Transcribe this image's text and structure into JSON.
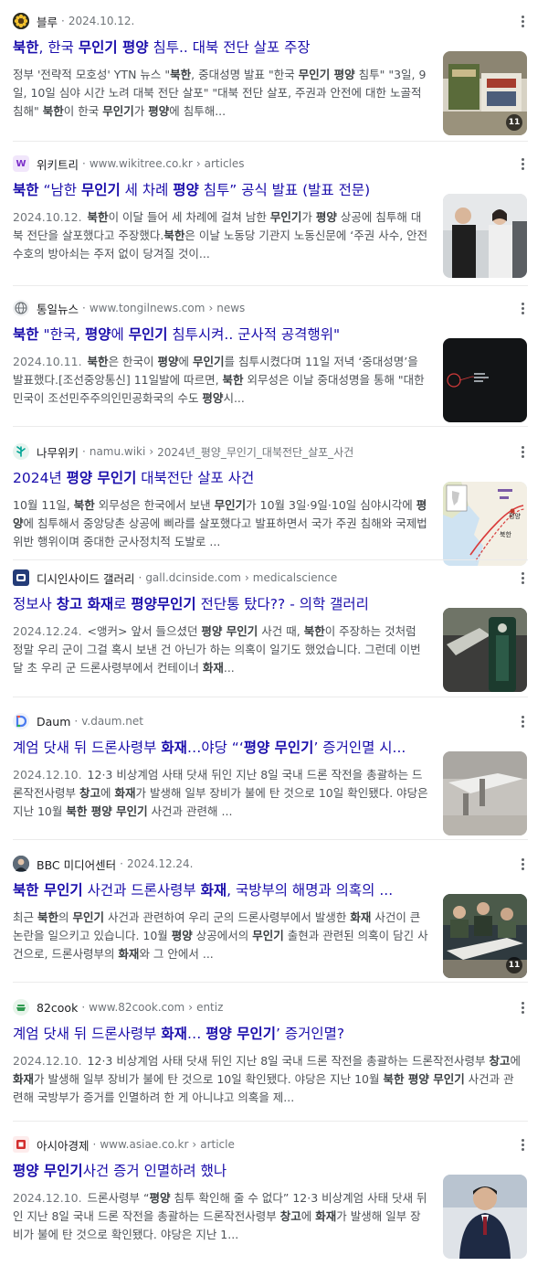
{
  "results": [
    {
      "favicon": "sunflower-favicon-icon",
      "source": "블루",
      "date": "2024.10.12.",
      "title_parts": [
        [
          "b",
          "북한"
        ],
        [
          "t",
          ", 한국 "
        ],
        [
          "b",
          "무인기 평양"
        ],
        [
          "t",
          " 침투.. 대북 전단 살포 주장"
        ]
      ],
      "snippet_parts": [
        [
          "t",
          "정부 '전략적 모호성' YTN 뉴스 \""
        ],
        [
          "b",
          "북한"
        ],
        [
          "t",
          ", 중대성명 발표 \"한국 "
        ],
        [
          "b",
          "무인기 평양"
        ],
        [
          "t",
          " 침투\" \"3일, 9일, 10일 심야 시간 노려 대북 전단 살포\" \"대북 전단 살포, 주권과 안전에 대한 노골적 침해\" "
        ],
        [
          "b",
          "북한"
        ],
        [
          "t",
          "이 한국 "
        ],
        [
          "b",
          "무인기"
        ],
        [
          "t",
          "가 "
        ],
        [
          "b",
          "평양"
        ],
        [
          "t",
          "에 침투해..."
        ]
      ],
      "image_count": "11"
    },
    {
      "favicon": "wikitree-favicon-icon",
      "source": "위키트리",
      "url": "www.wikitree.co.kr",
      "path": "articles",
      "title_parts": [
        [
          "b",
          "북한"
        ],
        [
          "t",
          " “남한 "
        ],
        [
          "b",
          "무인기"
        ],
        [
          "t",
          " 세 차례 "
        ],
        [
          "b",
          "평양"
        ],
        [
          "t",
          " 침투” 공식 발표 (발표 전문)"
        ]
      ],
      "date": "2024.10.12.",
      "snippet_parts": [
        [
          "b",
          "북한"
        ],
        [
          "t",
          "이 이달 들어 세 차례에 걸쳐 남한 "
        ],
        [
          "b",
          "무인기"
        ],
        [
          "t",
          "가 "
        ],
        [
          "b",
          "평양"
        ],
        [
          "t",
          " 상공에 침투해 대북 전단을 살포했다고 주장했다."
        ],
        [
          "b",
          "북한"
        ],
        [
          "t",
          "은 이날 노동당 기관지 노동신문에 ‘주권 사수, 안전 수호의 방아쇠는 주저 없이 당겨질 것이..."
        ]
      ]
    },
    {
      "favicon": "globe-favicon-icon",
      "source": "통일뉴스",
      "url": "www.tongilnews.com",
      "path": "news",
      "title_parts": [
        [
          "b",
          "북한"
        ],
        [
          "t",
          " \"한국, "
        ],
        [
          "b",
          "평양"
        ],
        [
          "t",
          "에 "
        ],
        [
          "b",
          "무인기"
        ],
        [
          "t",
          " 침투시켜.. 군사적 공격행위\""
        ]
      ],
      "date": "2024.10.11.",
      "snippet_parts": [
        [
          "b",
          "북한"
        ],
        [
          "t",
          "은 한국이 "
        ],
        [
          "b",
          "평양"
        ],
        [
          "t",
          "에 "
        ],
        [
          "b",
          "무인기"
        ],
        [
          "t",
          "를 침투시켰다며 11일 저녁 ‘중대성명’을 발표했다.[조선중앙통신] 11일발에 따르면, "
        ],
        [
          "b",
          "북한"
        ],
        [
          "t",
          " 외무성은 이날 중대성명을 통해 \"대한민국이 조선민주주의인민공화국의 수도 "
        ],
        [
          "b",
          "평양"
        ],
        [
          "t",
          "시..."
        ]
      ]
    },
    {
      "favicon": "namuwiki-favicon-icon",
      "source": "나무위키",
      "url": "namu.wiki",
      "path": "2024년_평양_무인기_대북전단_살포_사건",
      "title_parts": [
        [
          "t",
          "2024년 "
        ],
        [
          "b",
          "평양 무인기"
        ],
        [
          "t",
          " 대북전단 살포 사건"
        ]
      ],
      "snippet_parts": [
        [
          "t",
          "10월 11일, "
        ],
        [
          "b",
          "북한"
        ],
        [
          "t",
          " 외무성은 한국에서 보낸 "
        ],
        [
          "b",
          "무인기"
        ],
        [
          "t",
          "가 10월 3일·9일·10일 심야시각에 "
        ],
        [
          "b",
          "평양"
        ],
        [
          "t",
          "에 침투해서 중앙당촌 상공에 삐라를 살포했다고 발표하면서 국가 주권 침해와 국제법 위반 행위이며 중대한 군사정치적 도발로 ..."
        ]
      ],
      "map_labels": [
        "평양",
        "북한"
      ]
    },
    {
      "favicon": "dcinside-favicon-icon",
      "source": "디시인사이드 갤러리",
      "url": "gall.dcinside.com",
      "path": "medicalscience",
      "title_parts": [
        [
          "t",
          "정보사 "
        ],
        [
          "b",
          "창고 화재"
        ],
        [
          "t",
          "로 "
        ],
        [
          "b",
          "평양무인기"
        ],
        [
          "t",
          " 전단통 탔다?? - 의학 갤러리"
        ]
      ],
      "date": "2024.12.24.",
      "snippet_parts": [
        [
          "t",
          "<앵커> 앞서 들으셨던 "
        ],
        [
          "b",
          "평양 무인기"
        ],
        [
          "t",
          " 사건 때, "
        ],
        [
          "b",
          "북한"
        ],
        [
          "t",
          "이 주장하는 것처럼 정말 우리 군이 그걸 혹시 보낸 건 아닌가 하는 의혹이 일기도 했었습니다. 그런데 이번 달 초 우리 군 드론사령부에서 컨테이너 "
        ],
        [
          "b",
          "화재"
        ],
        [
          "t",
          "..."
        ]
      ]
    },
    {
      "favicon": "daum-favicon-icon",
      "source": "Daum",
      "url": "v.daum.net",
      "title_parts": [
        [
          "t",
          "계엄 닷새 뒤 드론사령부 "
        ],
        [
          "b",
          "화재"
        ],
        [
          "t",
          "…야당 “‘"
        ],
        [
          "b",
          "평양 무인기"
        ],
        [
          "t",
          "’ 증거인멸 시..."
        ]
      ],
      "date": "2024.12.10.",
      "snippet_parts": [
        [
          "t",
          "12·3 비상계엄 사태 닷새 뒤인 지난 8일 국내 드론 작전을 총괄하는 드론작전사령부 "
        ],
        [
          "b",
          "창고"
        ],
        [
          "t",
          "에 "
        ],
        [
          "b",
          "화재"
        ],
        [
          "t",
          "가 발생해 일부 장비가 불에 탄 것으로 10일 확인됐다. 야당은 지난 10월 "
        ],
        [
          "b",
          "북한 평양 무인기"
        ],
        [
          "t",
          " 사건과 관련해 ..."
        ]
      ]
    },
    {
      "favicon": "bbc-favicon-icon",
      "source": "BBC 미디어센터",
      "date": "2024.12.24.",
      "title_parts": [
        [
          "b",
          "북한 무인기"
        ],
        [
          "t",
          " 사건과 드론사령부 "
        ],
        [
          "b",
          "화재"
        ],
        [
          "t",
          ", 국방부의 해명과 의혹의 ..."
        ]
      ],
      "snippet_parts": [
        [
          "t",
          "최근 "
        ],
        [
          "b",
          "북한"
        ],
        [
          "t",
          "의 "
        ],
        [
          "b",
          "무인기"
        ],
        [
          "t",
          " 사건과 관련하여 우리 군의 드론사령부에서 발생한 "
        ],
        [
          "b",
          "화재"
        ],
        [
          "t",
          " 사건이 큰 논란을 일으키고 있습니다. 10월 "
        ],
        [
          "b",
          "평양"
        ],
        [
          "t",
          " 상공에서의 "
        ],
        [
          "b",
          "무인기"
        ],
        [
          "t",
          " 출현과 관련된 의혹이 담긴 사건으로, 드론사령부의 "
        ],
        [
          "b",
          "화재"
        ],
        [
          "t",
          "와 그 안에서 ..."
        ]
      ],
      "image_count": "11"
    },
    {
      "favicon": "82cook-favicon-icon",
      "source": "82cook",
      "url": "www.82cook.com",
      "path": "entiz",
      "title_parts": [
        [
          "t",
          "계엄 닷새 뒤 드론사령부 "
        ],
        [
          "b",
          "화재"
        ],
        [
          "t",
          "… "
        ],
        [
          "b",
          "평양 무인기"
        ],
        [
          "t",
          "’ 증거인멸?"
        ]
      ],
      "date": "2024.12.10.",
      "snippet_parts": [
        [
          "t",
          "12·3 비상계엄 사태 닷새 뒤인 지난 8일 국내 드론 작전을 총괄하는 드론작전사령부 "
        ],
        [
          "b",
          "창고"
        ],
        [
          "t",
          "에 "
        ],
        [
          "b",
          "화재"
        ],
        [
          "t",
          "가 발생해 일부 장비가 불에 탄 것으로 10일 확인됐다. 야당은 지난 10월 "
        ],
        [
          "b",
          "북한 평양 무인기"
        ],
        [
          "t",
          " 사건과 관련해 국방부가 증거를 인멸하려 한 게 아니냐고 의혹을 제..."
        ]
      ]
    },
    {
      "favicon": "asiae-favicon-icon",
      "source": "아시아경제",
      "url": "www.asiae.co.kr",
      "path": "article",
      "title_parts": [
        [
          "b",
          "평양 무인기"
        ],
        [
          "t",
          "사건 증거 인멸하려 했나"
        ]
      ],
      "date": "2024.12.10.",
      "snippet_parts": [
        [
          "t",
          "드론사령부 “"
        ],
        [
          "b",
          "평양"
        ],
        [
          "t",
          " 침투 확인해 줄 수 없다” 12·3 비상계엄 사태 닷새 뒤인 지난 8일 국내 드론 작전을 총괄하는 드론작전사령부 "
        ],
        [
          "b",
          "창고"
        ],
        [
          "t",
          "에 "
        ],
        [
          "b",
          "화재"
        ],
        [
          "t",
          "가 발생해 일부 장비가 불에 탄 것으로 확인됐다. 야당은 지난 1..."
        ]
      ]
    }
  ],
  "colors": {
    "title_link": "#1a0dab",
    "snippet": "#4d5156",
    "meta": "#70757a"
  }
}
